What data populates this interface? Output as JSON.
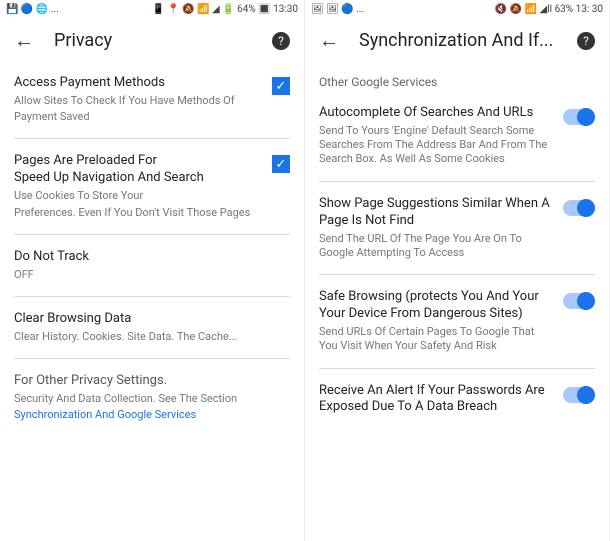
{
  "left": {
    "status": {
      "left_icons": "💾 🔵 🌐 ...",
      "right_text": "📱 📍 🔕 📶 ◢ 🔋 64% 🔳 13:30"
    },
    "title": "Privacy",
    "items": [
      {
        "title": "Access Payment Methods",
        "sub1": "Allow Sites To Check If You Have Methods Of",
        "sub2": "Payment Saved"
      },
      {
        "title": "Pages Are Preloaded For",
        "sub1": "Speed Up Navigation And Search",
        "sub2": "Use Cookies To Store Your",
        "sub3": "Preferences. Even If You Don't Visit Those Pages"
      },
      {
        "title": "Do Not Track",
        "sub1": "OFF"
      },
      {
        "title": "Clear Browsing Data",
        "sub1": "Clear History. Cookies. Site Data. The Cache..."
      },
      {
        "title": "For Other Privacy Settings.",
        "sub1": "Security And Data Collection. See The Section",
        "link": "Synchronization And Google Services"
      }
    ]
  },
  "right": {
    "status": {
      "left_icons": "🖼 🖼 🔵 ...",
      "right_text": "🔇 🔕 📶 ◢ll 63% 13: 30"
    },
    "title": "Synchronization And If...",
    "section_header": "Other Google Services",
    "items": [
      {
        "title": "Autocomplete Of Searches And URLs",
        "sub": "Send To Yours 'Engine' Default Search Some Searches From The Address Bar And From The Search Box. As Well As Some Cookies"
      },
      {
        "title": "Show Page Suggestions Similar When A Page Is Not Find",
        "sub": "Send The URL Of The Page You Are On To Google Attempting To Access"
      },
      {
        "title": "Safe Browsing (protects You And Your Your Device From Dangerous Sites)",
        "sub": "Send URLs Of Certain Pages To Google That You Visit When Your Safety And Risk"
      },
      {
        "title": "Receive An Alert If Your Passwords Are Exposed Due To A Data Breach",
        "sub": ""
      }
    ]
  }
}
